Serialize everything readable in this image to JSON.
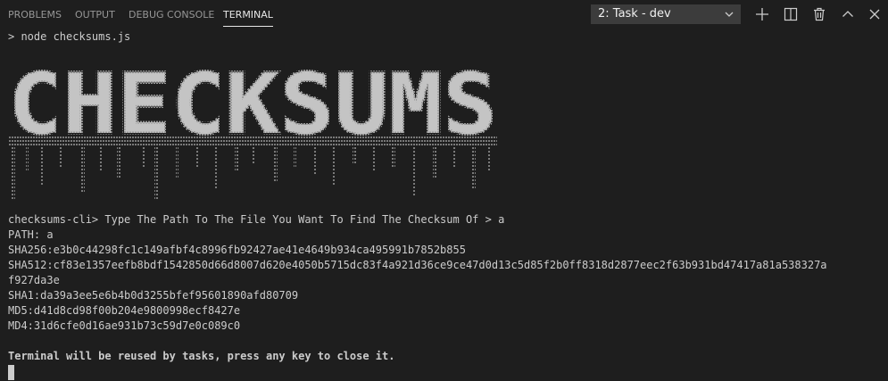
{
  "tabs": [
    {
      "label": "PROBLEMS"
    },
    {
      "label": "OUTPUT"
    },
    {
      "label": "DEBUG CONSOLE"
    },
    {
      "label": "TERMINAL"
    }
  ],
  "active_tab": "TERMINAL",
  "task_selector": {
    "value": "2: Task - dev"
  },
  "toolbar_icons": [
    "add-icon",
    "split-icon",
    "trash-icon",
    "chevron-up-icon",
    "close-icon"
  ],
  "terminal": {
    "command": "> node checksums.js",
    "banner_text": "CHECKSUMS",
    "prompt_line": "checksums-cli> Type The Path To The File You Want To Find The Checksum Of > a",
    "path_line": "PATH: a",
    "sha256_line": "SHA256:e3b0c44298fc1c149afbf4c8996fb92427ae41e4649b934ca495991b7852b855",
    "sha512_line": "SHA512:cf83e1357eefb8bdf1542850d66d8007d620e4050b5715dc83f4a921d36ce9ce47d0d13c5d85f2b0ff8318d2877eec2f63b931bd47417a81a538327a",
    "sha512_cont": "f927da3e",
    "sha1_line": "SHA1:da39a3ee5e6b4b0d3255bfef95601890afd80709",
    "md5_line": "MD5:d41d8cd98f00b204e9800998ecf8427e",
    "md4_line": "MD4:31d6cfe0d16ae931b73c59d7e0c089c0",
    "footer_line": "Terminal will be reused by tasks, press any key to close it."
  },
  "colors": {
    "background": "#1e1e1e",
    "text": "#cccccc",
    "inactive_tab": "#969696",
    "active_tab": "#e7e7e7",
    "select_bg": "#3c3c3c"
  }
}
